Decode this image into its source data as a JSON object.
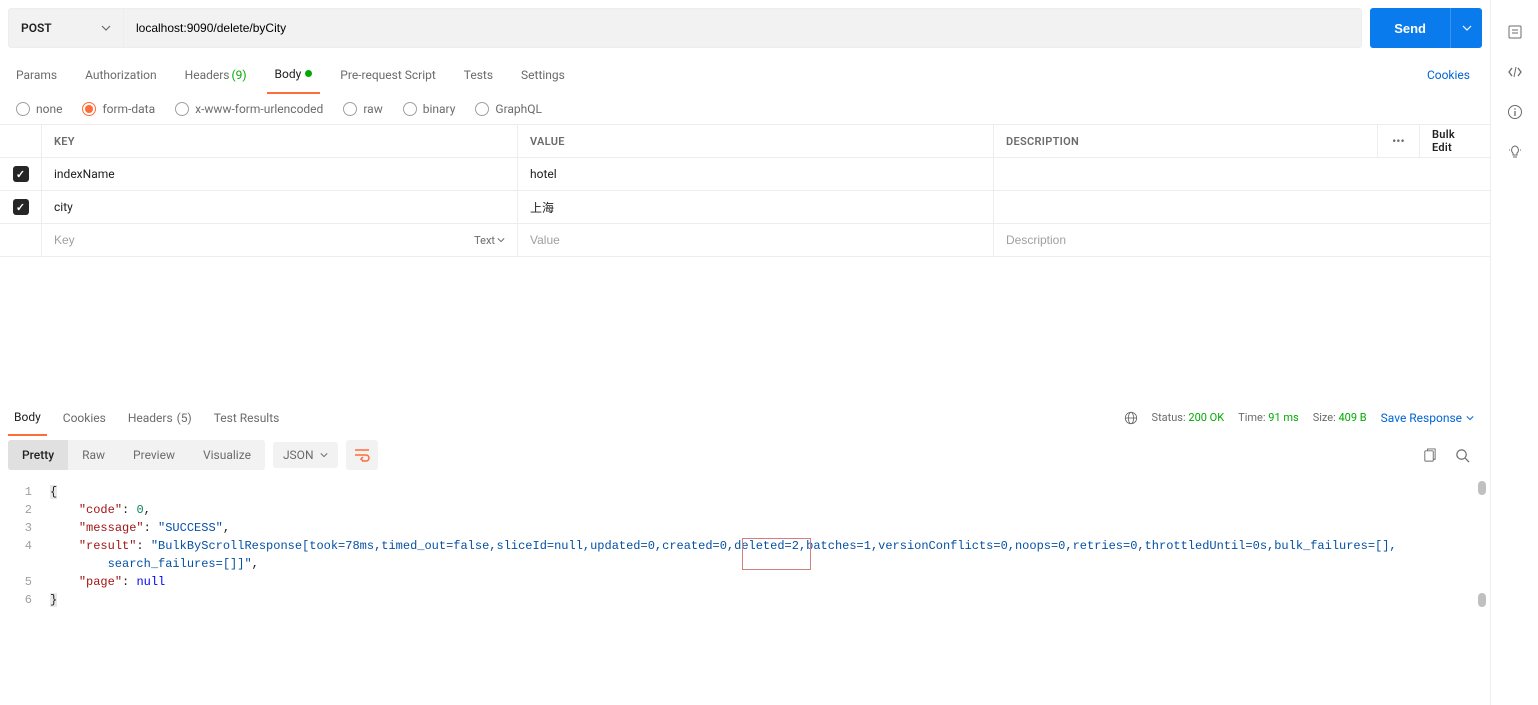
{
  "request": {
    "method": "POST",
    "url": "localhost:9090/delete/byCity",
    "send_label": "Send"
  },
  "tabs": {
    "params": "Params",
    "auth": "Authorization",
    "headers": "Headers",
    "headers_count": "(9)",
    "body": "Body",
    "prereq": "Pre-request Script",
    "tests": "Tests",
    "settings": "Settings",
    "cookies_link": "Cookies"
  },
  "body_types": {
    "none": "none",
    "form_data": "form-data",
    "xwww": "x-www-form-urlencoded",
    "raw": "raw",
    "binary": "binary",
    "graphql": "GraphQL"
  },
  "form_table": {
    "header_key": "KEY",
    "header_value": "VALUE",
    "header_desc": "DESCRIPTION",
    "bulk_edit": "Bulk Edit",
    "rows": [
      {
        "key": "indexName",
        "value": "hotel",
        "desc": ""
      },
      {
        "key": "city",
        "value": "上海",
        "desc": ""
      }
    ],
    "placeholder_key": "Key",
    "placeholder_value": "Value",
    "placeholder_desc": "Description",
    "key_type_label": "Text"
  },
  "response": {
    "tabs": {
      "body": "Body",
      "cookies": "Cookies",
      "headers": "Headers",
      "headers_count": "(5)",
      "tests": "Test Results"
    },
    "status_label": "Status:",
    "status_value": "200 OK",
    "time_label": "Time:",
    "time_value": "91 ms",
    "size_label": "Size:",
    "size_value": "409 B",
    "save_label": "Save Response",
    "views": {
      "pretty": "Pretty",
      "raw": "Raw",
      "preview": "Preview",
      "visualize": "Visualize"
    },
    "format": "JSON"
  },
  "json": {
    "code": 0,
    "message": "SUCCESS",
    "result_prefix": "BulkByScrollResponse[took=78ms,timed_out=false,sliceId=null,updated=0,created=0,",
    "result_hl": "deleted=2",
    "result_suffix": ",batches=1,versionConflicts=0,noops=0,retries=0,throttledUntil=0s,bulk_failures=[],",
    "result_wrap": "search_failures=[]]",
    "page": "null"
  }
}
